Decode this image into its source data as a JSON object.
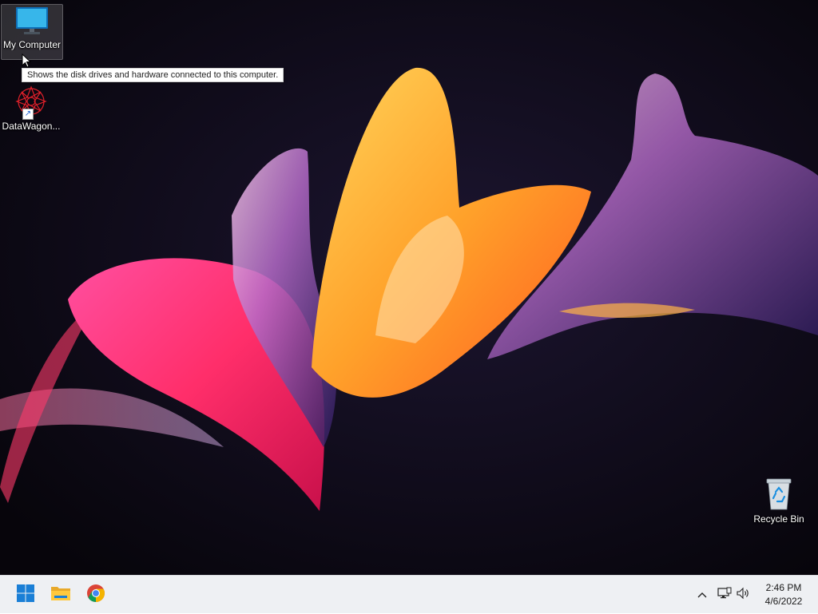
{
  "desktop": {
    "icons": [
      {
        "label": "My Computer",
        "icon": "computer-monitor-icon",
        "tooltip": "Shows the disk drives and hardware connected to this computer."
      },
      {
        "label": "DataWagon...",
        "icon": "datawagon-logo-icon",
        "shortcut": true
      },
      {
        "label": "Recycle Bin",
        "icon": "recycle-bin-icon"
      }
    ]
  },
  "taskbar": {
    "pinned": [
      {
        "name": "Start",
        "icon": "windows-logo-icon"
      },
      {
        "name": "File Explorer",
        "icon": "folder-icon"
      },
      {
        "name": "Google Chrome",
        "icon": "chrome-icon"
      }
    ],
    "tray": {
      "icons": [
        "chevron-up-icon",
        "network-icon",
        "volume-icon"
      ],
      "time": "2:46 PM",
      "date": "4/6/2022"
    }
  },
  "colors": {
    "wallpaper_background": "#0a0710",
    "taskbar": "#eef0f3",
    "accent_blue": "#1a7fd6"
  }
}
